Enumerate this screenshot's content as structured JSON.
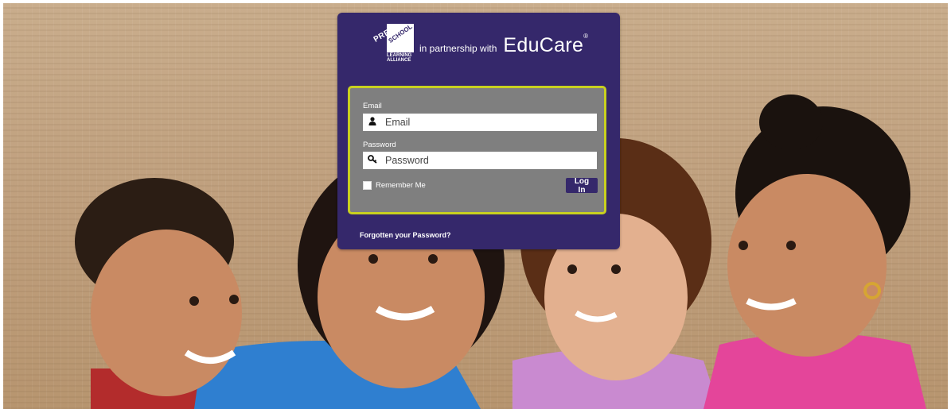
{
  "brand": {
    "logo_lines": [
      "PRE",
      "SCHOOL",
      "LEARNING",
      "ALLIANCE"
    ],
    "partner_text": "in partnership with",
    "educare_text": "EduCare",
    "registered_mark": "®"
  },
  "form": {
    "email_label": "Email",
    "email_placeholder": "Email",
    "password_label": "Password",
    "password_placeholder": "Password",
    "remember_label": "Remember Me",
    "login_label": "Log In"
  },
  "links": {
    "forgot_password": "Forgotten your Password?"
  },
  "icons": {
    "email": "user-icon",
    "password": "key-icon"
  },
  "colors": {
    "panel": "#35286b",
    "form_box": "#7f7f7f",
    "form_border": "#c9d11f",
    "button": "#35286b"
  }
}
